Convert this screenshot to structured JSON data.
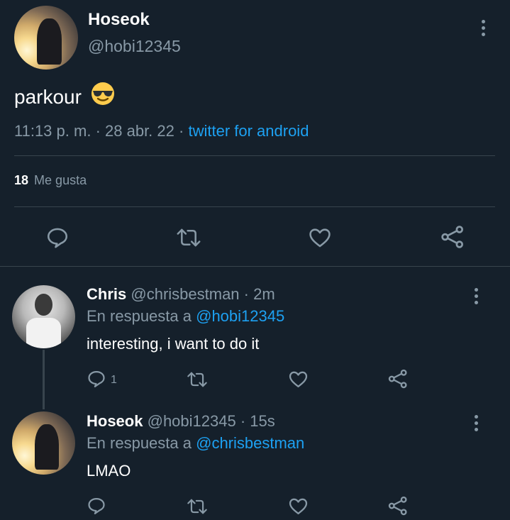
{
  "main_tweet": {
    "name": "Hoseok",
    "handle": "@hobi12345",
    "text": "parkour",
    "emoji": "😎",
    "time": "11:13 p. m.",
    "sep1": "·",
    "date": "28 abr. 22",
    "sep2": "·",
    "source": "twitter for android",
    "likes_count": "18",
    "likes_label": "Me gusta"
  },
  "replies": [
    {
      "name": "Chris",
      "handle": "@chrisbestman",
      "meta": "· 2m",
      "reply_prefix": "En respuesta a",
      "reply_to": "@hobi12345",
      "text": "interesting, i want to do it",
      "reply_count": "1"
    },
    {
      "name": "Hoseok",
      "handle": "@hobi12345",
      "meta": "· 15s",
      "reply_prefix": "En respuesta a",
      "reply_to": "@chrisbestman",
      "text": "LMAO",
      "reply_count": ""
    }
  ],
  "icons": {
    "reply": "reply-icon",
    "retweet": "retweet-icon",
    "like": "heart-icon",
    "share": "share-icon",
    "more": "more-options-icon"
  },
  "colors": {
    "background": "#15202b",
    "muted": "#8899a6",
    "accent": "#1da1f2",
    "divider": "#38444d"
  }
}
